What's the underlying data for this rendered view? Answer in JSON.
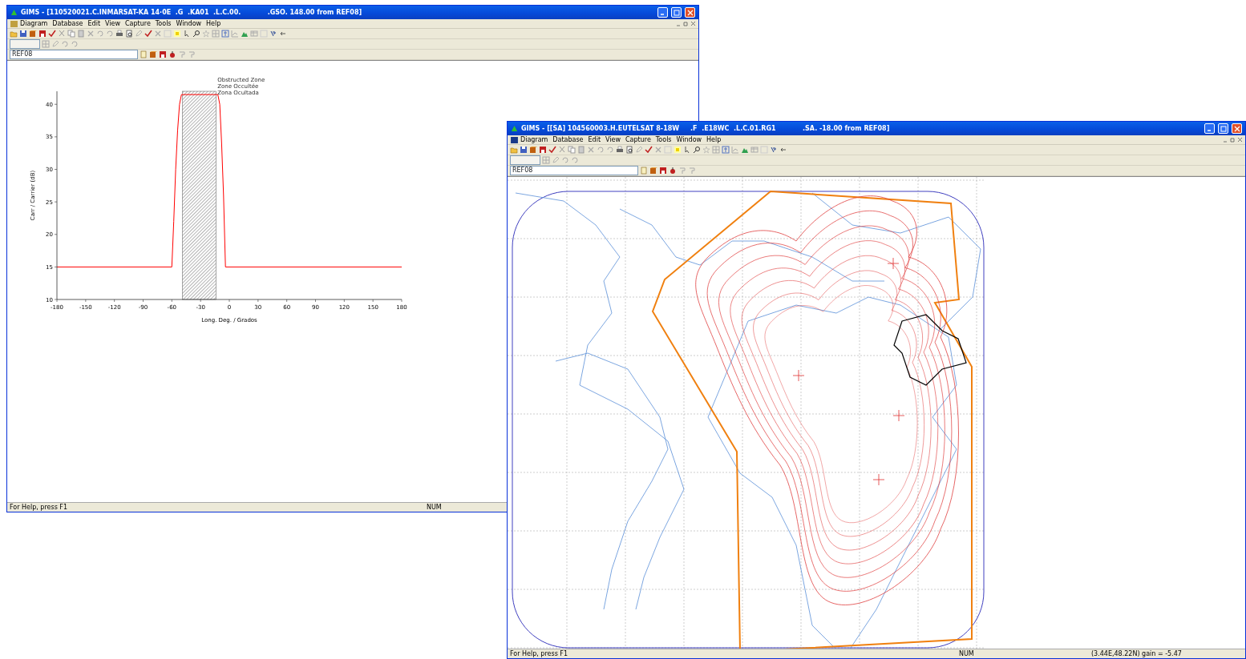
{
  "windows": [
    {
      "title": "GIMS - [110520021.C.INMARSAT-KA 14·0E  .G  .KA01  .L.C.00.            .GSO. 148.00 from REF08]",
      "menu": [
        "Diagram",
        "Database",
        "Edit",
        "View",
        "Capture",
        "Tools",
        "Window",
        "Help"
      ],
      "combo": {
        "value": "REF08"
      },
      "status": {
        "help": "For Help, press F1",
        "num": "NUM"
      },
      "content": {
        "kind": "chart",
        "chart_data": {
          "type": "line",
          "xlabel": "Long. Deg. / Grados",
          "ylabel": "Carr / Carrier (dB)",
          "x": [
            -180,
            -60,
            -58,
            -56,
            -54,
            -52,
            -50,
            -12,
            -10,
            -8,
            -6,
            -4,
            180
          ],
          "series": [
            {
              "color": "#ff0000",
              "values": [
                15,
                15,
                22,
                30,
                36,
                40,
                41.5,
                41.5,
                40,
                34,
                26,
                15,
                15
              ]
            }
          ],
          "xlim": [
            -180,
            180
          ],
          "ylim": [
            10,
            42
          ],
          "xticks": [
            -180,
            -150,
            -120,
            -90,
            -60,
            -30,
            0,
            30,
            60,
            90,
            120,
            150,
            180
          ],
          "yticks": [
            10,
            15,
            20,
            25,
            30,
            35,
            40
          ],
          "bands": [
            {
              "axis": "x",
              "from": -49,
              "to": -14
            }
          ],
          "annotations": [
            "Obstructed Zone",
            "Zone Occultée",
            "Zona Ocultada"
          ]
        }
      }
    },
    {
      "title": "GIMS - [[SA] 104560003.H.EUTELSAT 8-18W     .F  .E18WC  .L.C.01.RG1            .SA. -18.00 from REF08]",
      "menu": [
        "Diagram",
        "Database",
        "Edit",
        "View",
        "Capture",
        "Tools",
        "Window",
        "Help"
      ],
      "combo": {
        "value": "REF08"
      },
      "status": {
        "help": "For Help, press F1",
        "num": "NUM",
        "coords": "(3.44E,48.22N) gain = -5.47"
      },
      "content": {
        "kind": "map"
      }
    }
  ]
}
